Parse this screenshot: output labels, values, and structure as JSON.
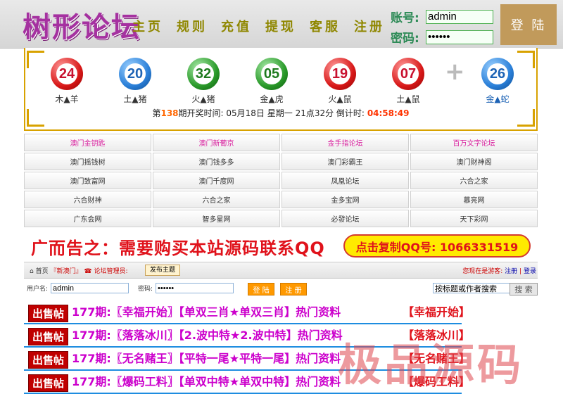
{
  "site": {
    "logo": "树形论坛"
  },
  "nav": [
    "主页",
    "规则",
    "充值",
    "提现",
    "客服",
    "注册"
  ],
  "login": {
    "username_label": "账号:",
    "username_value": "admin",
    "password_label": "密码:",
    "password_value": "••••••",
    "button": "登 陆"
  },
  "lottery": {
    "balls": [
      {
        "number": "24",
        "color": "red",
        "label": "木▲羊"
      },
      {
        "number": "20",
        "color": "blue",
        "label": "土▲猪"
      },
      {
        "number": "32",
        "color": "green",
        "label": "火▲猪"
      },
      {
        "number": "05",
        "color": "green",
        "label": "金▲虎"
      },
      {
        "number": "19",
        "color": "red",
        "label": "火▲鼠"
      },
      {
        "number": "07",
        "color": "red",
        "label": "土▲鼠"
      }
    ],
    "plus": "+",
    "special": {
      "number": "26",
      "color": "blue",
      "label": "金▲蛇"
    },
    "info_prefix": "第",
    "issue": "138",
    "info_mid": "期开奖时间: 05月18日 星期一 21点32分   倒计时:",
    "countdown": "04:58:49"
  },
  "links": [
    {
      "text": "澳门金钥匙",
      "pink": true
    },
    {
      "text": "澳门新葡京",
      "pink": true
    },
    {
      "text": "金手指论坛",
      "pink": true
    },
    {
      "text": "百万文字论坛",
      "pink": true
    },
    {
      "text": "澳门摇钱树",
      "pink": false
    },
    {
      "text": "澳门钱多多",
      "pink": false
    },
    {
      "text": "澳门彩霸王",
      "pink": false
    },
    {
      "text": "澳门财神阁",
      "pink": false
    },
    {
      "text": "澳门致富网",
      "pink": false
    },
    {
      "text": "澳门千度网",
      "pink": false
    },
    {
      "text": "凤凰论坛",
      "pink": false
    },
    {
      "text": "六合之家",
      "pink": false
    },
    {
      "text": "六合财神",
      "pink": false
    },
    {
      "text": "六合之家",
      "pink": false
    },
    {
      "text": "金多宝网",
      "pink": false
    },
    {
      "text": "慕亮网",
      "pink": false
    },
    {
      "text": "广东会网",
      "pink": false
    },
    {
      "text": "智多星网",
      "pink": false
    },
    {
      "text": "必發论坛",
      "pink": false
    },
    {
      "text": "天下彩网",
      "pink": false
    }
  ],
  "ad": {
    "text": "广而告之：需要购买本站源码联系QQ",
    "button": "点击复制QQ号: 1066331519"
  },
  "forum": {
    "home": "首页",
    "section": "『新澳门』",
    "admin": "☎ 论坛管理员:",
    "post_button": "发布主题",
    "status_prefix": "您现在是游客:",
    "register": "注册",
    "sep": "|",
    "login": "登录",
    "user_label": "用户名:",
    "user_value": "admin",
    "pass_label": "密码:",
    "pass_value": "••••••",
    "login_btn": "登 陆",
    "register_btn": "注 册",
    "search_placeholder": "按标题或作者搜索",
    "search_btn": "搜 索"
  },
  "posts": [
    {
      "tag": "出售帖",
      "title": "177期:〖幸福开始〗【单双三肖★单双三肖】热门资料",
      "right": "【幸福开始】"
    },
    {
      "tag": "出售帖",
      "title": "177期:〖落落冰川〗【2.波中特★2.波中特】热门资料",
      "right": "【落落冰川】"
    },
    {
      "tag": "出售帖",
      "title": "177期:〖无名赌王〗【平特一尾★平特一尾】热门资料",
      "right": "【无名赌王】"
    },
    {
      "tag": "出售帖",
      "title": "177期:〖爆码工料〗【单双中特★单双中特】热门资料",
      "right": "【爆码工料】"
    }
  ],
  "watermark": "极品源码"
}
